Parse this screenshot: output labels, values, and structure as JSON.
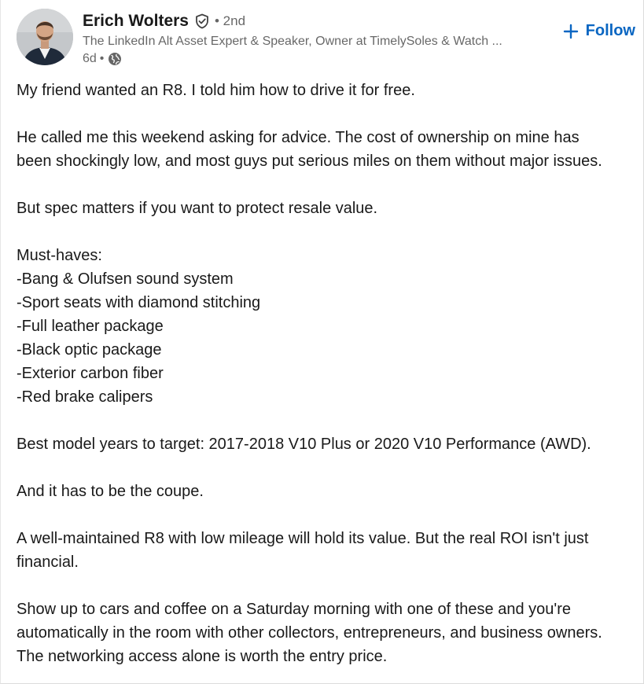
{
  "post": {
    "author": {
      "name": "Erich Wolters",
      "degree": "• 2nd",
      "headline": "The LinkedIn Alt Asset Expert & Speaker, Owner at TimelySoles & Watch ...",
      "time": "6d",
      "time_separator": "•",
      "verified_icon": "shield-check-icon",
      "visibility_icon": "globe-icon"
    },
    "follow_label": "Follow",
    "accent_color": "#0a66c2",
    "paragraphs": [
      {
        "lines": [
          "My friend wanted an R8. I told him how to drive it for free."
        ]
      },
      {
        "lines": [
          "He called me this weekend asking for advice. The cost of ownership on mine has",
          "been shockingly low, and most guys put serious miles on them without major issues."
        ]
      },
      {
        "lines": [
          "But spec matters if you want to protect resale value."
        ]
      },
      {
        "lines": [
          "Must-haves:",
          "-Bang & Olufsen sound system",
          "-Sport seats with diamond stitching",
          "-Full leather package",
          "-Black optic package",
          "-Exterior carbon fiber",
          "-Red brake calipers"
        ]
      },
      {
        "lines": [
          "Best model years to target: 2017-2018 V10 Plus or 2020 V10 Performance (AWD)."
        ]
      },
      {
        "lines": [
          "And it has to be the coupe."
        ]
      },
      {
        "lines": [
          "A well-maintained R8 with low mileage will hold its value. But the real ROI isn't just",
          "financial."
        ]
      },
      {
        "lines": [
          "Show up to cars and coffee on a Saturday morning with one of these and you're",
          "automatically in the room with other collectors, entrepreneurs, and business owners.",
          "The networking access alone is worth the entry price."
        ]
      }
    ]
  }
}
